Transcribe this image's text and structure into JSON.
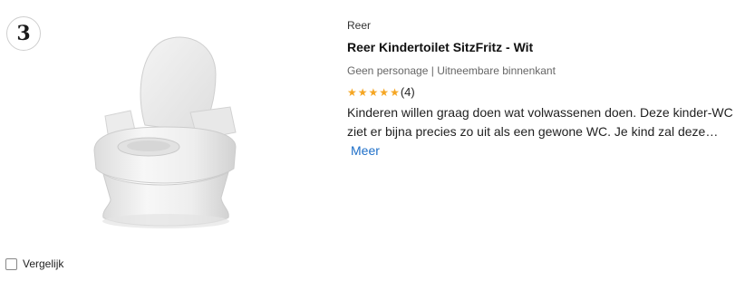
{
  "rank": "3",
  "product": {
    "brand": "Reer",
    "title": "Reer Kindertoilet SitzFritz - Wit",
    "features": "Geen personage | Uitneembare binnenkant",
    "rating": {
      "stars": 5,
      "count_label": "(4)",
      "star_color": "#f5a623"
    },
    "description": "Kinderen willen graag doen wat volwassenen doen. Deze kinder-WC ziet er bijna precies zo uit als een gewone WC. Je kind zal deze…",
    "more_label": "Meer",
    "link_color": "#1e6fc8"
  },
  "compare": {
    "label": "Vergelijk",
    "checked": false
  }
}
